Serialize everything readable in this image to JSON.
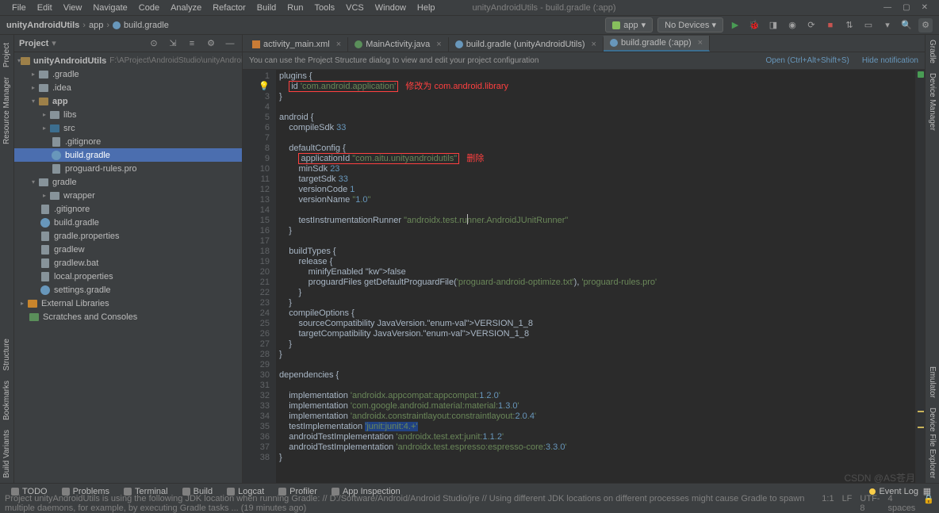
{
  "menu": [
    "File",
    "Edit",
    "View",
    "Navigate",
    "Code",
    "Analyze",
    "Refactor",
    "Build",
    "Run",
    "Tools",
    "VCS",
    "Window",
    "Help"
  ],
  "window_title": "unityAndroidUtils - build.gradle (:app)",
  "breadcrumb": [
    "unityAndroidUtils",
    "app",
    "build.gradle"
  ],
  "run_config": "app",
  "device_label": "No Devices ▾",
  "project_panel_title": "Project",
  "tree": {
    "root": {
      "label": "unityAndroidUtils",
      "path": "F:\\AProject\\AndroidStudio\\unityAndroidUtils"
    },
    "gradle": ".gradle",
    "idea": ".idea",
    "app": "app",
    "libs": "libs",
    "src": "src",
    "gitignore_app": ".gitignore",
    "build_gradle_app": "build.gradle",
    "proguard": "proguard-rules.pro",
    "gradle_folder": "gradle",
    "wrapper": "wrapper",
    "gitignore_root": ".gitignore",
    "build_gradle_root": "build.gradle",
    "gradle_properties": "gradle.properties",
    "gradlew": "gradlew",
    "gradlew_bat": "gradlew.bat",
    "local_properties": "local.properties",
    "settings_gradle": "settings.gradle",
    "external_libs": "External Libraries",
    "scratches": "Scratches and Consoles"
  },
  "tabs": [
    {
      "label": "activity_main.xml",
      "active": false
    },
    {
      "label": "MainActivity.java",
      "active": false
    },
    {
      "label": "build.gradle (unityAndroidUtils)",
      "active": false
    },
    {
      "label": "build.gradle (:app)",
      "active": true
    }
  ],
  "notification": {
    "msg": "You can use the Project Structure dialog to view and edit your project configuration",
    "open": "Open (Ctrl+Alt+Shift+S)",
    "hide": "Hide notification"
  },
  "code_lines": [
    {
      "n": 1,
      "t": "plugins {"
    },
    {
      "n": 2,
      "t": "    id 'com.android.application'",
      "box1": true,
      "anno": "修改为 com.android.library"
    },
    {
      "n": 3,
      "t": "}"
    },
    {
      "n": 4,
      "t": ""
    },
    {
      "n": 5,
      "t": "android {"
    },
    {
      "n": 6,
      "t": "    compileSdk 33"
    },
    {
      "n": 7,
      "t": ""
    },
    {
      "n": 8,
      "t": "    defaultConfig {"
    },
    {
      "n": 9,
      "t": "        applicationId \"com.aitu.unityandroidutils\"",
      "box2": true,
      "anno": "删除"
    },
    {
      "n": 10,
      "t": "        minSdk 23"
    },
    {
      "n": 11,
      "t": "        targetSdk 33"
    },
    {
      "n": 12,
      "t": "        versionCode 1"
    },
    {
      "n": 13,
      "t": "        versionName \"1.0\""
    },
    {
      "n": 14,
      "t": ""
    },
    {
      "n": 15,
      "t": "        testInstrumentationRunner \"androidx.test.runner.AndroidJUnitRunner\""
    },
    {
      "n": 16,
      "t": "    }"
    },
    {
      "n": 17,
      "t": ""
    },
    {
      "n": 18,
      "t": "    buildTypes {"
    },
    {
      "n": 19,
      "t": "        release {"
    },
    {
      "n": 20,
      "t": "            minifyEnabled false"
    },
    {
      "n": 21,
      "t": "            proguardFiles getDefaultProguardFile('proguard-android-optimize.txt'), 'proguard-rules.pro'"
    },
    {
      "n": 22,
      "t": "        }"
    },
    {
      "n": 23,
      "t": "    }"
    },
    {
      "n": 24,
      "t": "    compileOptions {"
    },
    {
      "n": 25,
      "t": "        sourceCompatibility JavaVersion.VERSION_1_8"
    },
    {
      "n": 26,
      "t": "        targetCompatibility JavaVersion.VERSION_1_8"
    },
    {
      "n": 27,
      "t": "    }"
    },
    {
      "n": 28,
      "t": "}"
    },
    {
      "n": 29,
      "t": ""
    },
    {
      "n": 30,
      "t": "dependencies {"
    },
    {
      "n": 31,
      "t": ""
    },
    {
      "n": 32,
      "t": "    implementation 'androidx.appcompat:appcompat:1.2.0'"
    },
    {
      "n": 33,
      "t": "    implementation 'com.google.android.material:material:1.3.0'"
    },
    {
      "n": 34,
      "t": "    implementation 'androidx.constraintlayout:constraintlayout:2.0.4'"
    },
    {
      "n": 35,
      "t": "    testImplementation 'junit:junit:4.+'"
    },
    {
      "n": 36,
      "t": "    androidTestImplementation 'androidx.test.ext:junit:1.1.2'"
    },
    {
      "n": 37,
      "t": "    androidTestImplementation 'androidx.test.espresso:espresso-core:3.3.0'"
    },
    {
      "n": 38,
      "t": "}"
    }
  ],
  "bottom_tools": [
    "TODO",
    "Problems",
    "Terminal",
    "Build",
    "Logcat",
    "Profiler",
    "App Inspection"
  ],
  "event_log": "Event Log",
  "statusbar": {
    "msg": "Project unityAndroidUtils is using the following JDK location when running Gradle: // D:/Software/Android/Android Studio/jre // Using different JDK locations on different processes might cause Gradle to spawn multiple daemons, for example, by executing Gradle tasks ... (19 minutes ago)",
    "pos": "1:1",
    "lf": "LF",
    "enc": "UTF-8",
    "spaces": "4 spaces"
  },
  "side_left": [
    "Project",
    "Resource Manager"
  ],
  "side_left_bottom": [
    "Structure",
    "Bookmarks",
    "Build Variants"
  ],
  "side_right": [
    "Gradle",
    "Device Manager",
    "Emulator",
    "Device File Explorer"
  ],
  "watermark": "CSDN @AS苍月"
}
